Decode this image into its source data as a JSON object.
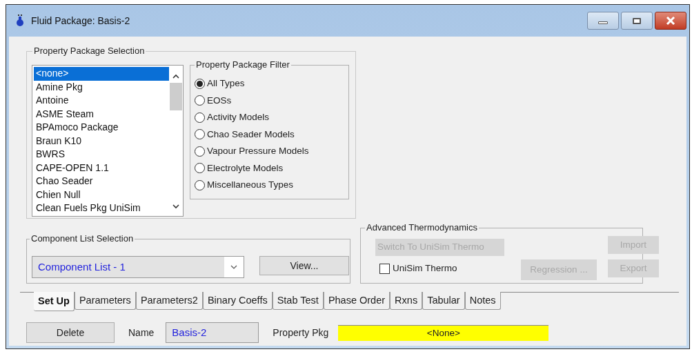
{
  "window": {
    "title": "Fluid Package: Basis-2"
  },
  "property_package_selection": {
    "legend": "Property Package Selection",
    "items": [
      {
        "label": "<none>",
        "selected": true
      },
      {
        "label": "Amine Pkg",
        "selected": false
      },
      {
        "label": "Antoine",
        "selected": false
      },
      {
        "label": "ASME Steam",
        "selected": false
      },
      {
        "label": "BPAmoco Package",
        "selected": false
      },
      {
        "label": "Braun K10",
        "selected": false
      },
      {
        "label": "BWRS",
        "selected": false
      },
      {
        "label": "CAPE-OPEN 1.1",
        "selected": false
      },
      {
        "label": "Chao Seader",
        "selected": false
      },
      {
        "label": "Chien Null",
        "selected": false
      },
      {
        "label": "Clean Fuels Pkg UniSim",
        "selected": false
      }
    ],
    "filter": {
      "legend": "Property Package Filter",
      "options": [
        {
          "label": "All Types",
          "selected": true
        },
        {
          "label": "EOSs",
          "selected": false
        },
        {
          "label": "Activity Models",
          "selected": false
        },
        {
          "label": "Chao Seader Models",
          "selected": false
        },
        {
          "label": "Vapour Pressure Models",
          "selected": false
        },
        {
          "label": "Electrolyte Models",
          "selected": false
        },
        {
          "label": "Miscellaneous Types",
          "selected": false
        }
      ]
    }
  },
  "component_list_selection": {
    "legend": "Component List Selection",
    "value": "Component List - 1",
    "view_button": "View..."
  },
  "advanced_thermodynamics": {
    "legend": "Advanced Thermodynamics",
    "switch_button": "Switch To UniSim Thermo",
    "checkbox": {
      "label": "UniSim Thermo",
      "checked": false
    },
    "regression_button": "Regression ...",
    "import_button": "Import",
    "export_button": "Export"
  },
  "tabs": [
    {
      "label": "Set Up",
      "selected": true
    },
    {
      "label": "Parameters",
      "selected": false
    },
    {
      "label": "Parameters2",
      "selected": false
    },
    {
      "label": "Binary Coeffs",
      "selected": false
    },
    {
      "label": "Stab Test",
      "selected": false
    },
    {
      "label": "Phase Order",
      "selected": false
    },
    {
      "label": "Rxns",
      "selected": false
    },
    {
      "label": "Tabular",
      "selected": false
    },
    {
      "label": "Notes",
      "selected": false
    }
  ],
  "footer": {
    "delete_button": "Delete",
    "name_label": "Name",
    "name_value": "Basis-2",
    "property_pkg_label": "Property Pkg",
    "property_pkg_value": "<None>"
  }
}
